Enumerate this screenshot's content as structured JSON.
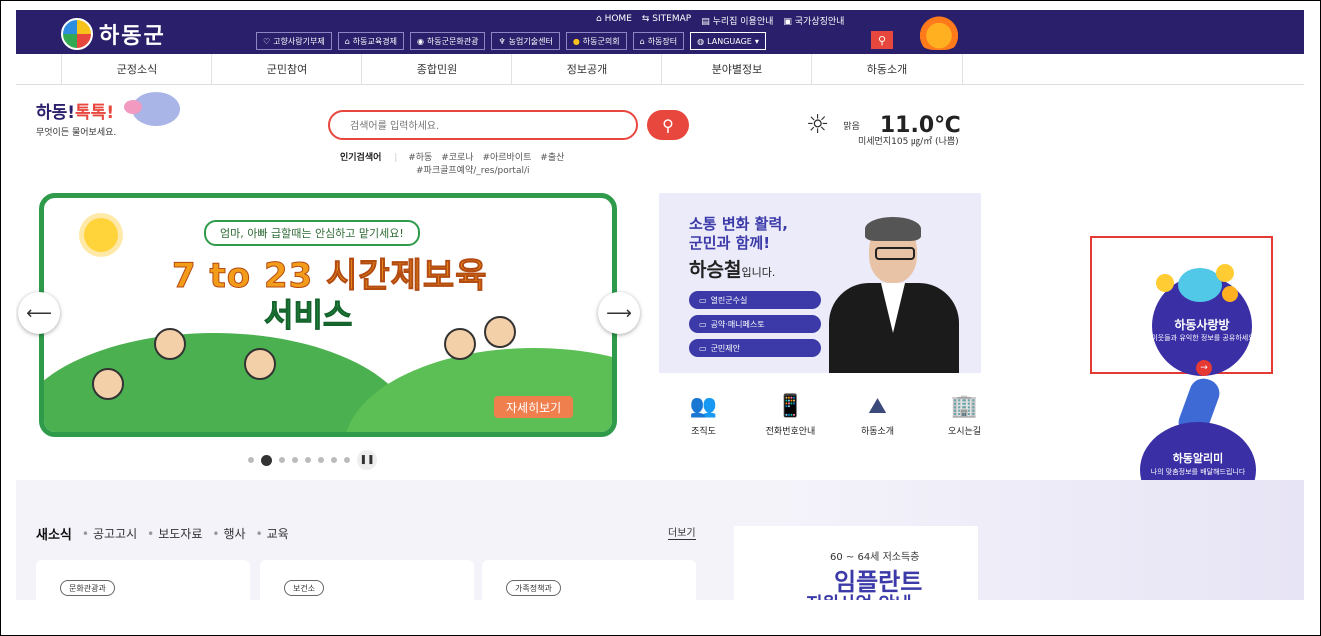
{
  "header": {
    "logo_text": "하동군",
    "util_links": [
      "HOME",
      "SITEMAP",
      "누리집 이용안내",
      "국가상징안내"
    ],
    "quick_links": [
      {
        "label": "고향사랑기부제",
        "icon": "heart-icon"
      },
      {
        "label": "하동교육경제",
        "icon": "building-icon"
      },
      {
        "label": "하동군문화관광",
        "icon": "location-icon"
      },
      {
        "label": "농업기술센터",
        "icon": "sprout-icon"
      },
      {
        "label": "하동군의회",
        "icon": "sun-icon"
      },
      {
        "label": "하동장터",
        "icon": "shop-icon"
      },
      {
        "label": "LANGUAGE",
        "icon": "globe-icon"
      }
    ]
  },
  "gnb": [
    "군정소식",
    "군민참여",
    "종합민원",
    "정보공개",
    "분야별정보",
    "하동소개"
  ],
  "talk": {
    "title_a": "하동!",
    "title_b": "톡톡!",
    "sub": "무엇이든 물어보세요."
  },
  "search": {
    "placeholder": "검색어를 입력하세요.",
    "popular_label": "인기검색어",
    "keywords": [
      "#하동",
      "#코로나",
      "#아르바이트",
      "#출산"
    ],
    "keywords_line2": "#파크골프예약/_res/portal/i"
  },
  "weather": {
    "condition": "맑음",
    "temp": "11.0℃",
    "dust": "미세먼지105 ㎍/㎥ (나쁨)"
  },
  "banner": {
    "pill": "엄마, 아빠 급할때는 안심하고 맡기세요!",
    "title1": "7 to 23 시간제보육",
    "title2": "서비스",
    "more": "자세히보기",
    "prev": "⟵",
    "next": "⟶",
    "pause": "❚❚"
  },
  "mayor": {
    "slogan1": "소통 변화 활력,",
    "slogan2": "군민과 함께!",
    "name": "하승철",
    "name_suffix": "입니다.",
    "buttons": [
      "열린군수실",
      "공약·매니페스토",
      "군민제안"
    ]
  },
  "quick_icons": [
    {
      "label": "조직도",
      "icon": "people-icon",
      "glyph": "👥"
    },
    {
      "label": "전화번호안내",
      "icon": "phone-icon",
      "glyph": "📱"
    },
    {
      "label": "하동소개",
      "icon": "mountain-icon",
      "glyph": "⛰"
    },
    {
      "label": "오시는길",
      "icon": "map-pin-icon",
      "glyph": "🏢"
    }
  ],
  "promo_sarangbang": {
    "title": "하동사랑방",
    "sub": "이웃들과 유익한 정보를 공유하세요",
    "go": "→"
  },
  "promo_alimi": {
    "title": "하동알리미",
    "sub": "나의 맞춤정보를 배달해드립니다",
    "go": "→"
  },
  "news": {
    "main_tab": "새소식",
    "tabs": [
      "공고고시",
      "보도자료",
      "행사",
      "교육"
    ],
    "more": "더보기",
    "cards": [
      "문화관광과",
      "보건소",
      "가족정책과"
    ]
  },
  "side_banner": {
    "sub": "60 ~ 64세 저소득층",
    "title": "임플란트",
    "title2": "지원사업 안내"
  },
  "colors": {
    "navy": "#2a1f6b",
    "red": "#e8473d",
    "green": "#2e9a4a",
    "purple": "#3b2fa6"
  }
}
